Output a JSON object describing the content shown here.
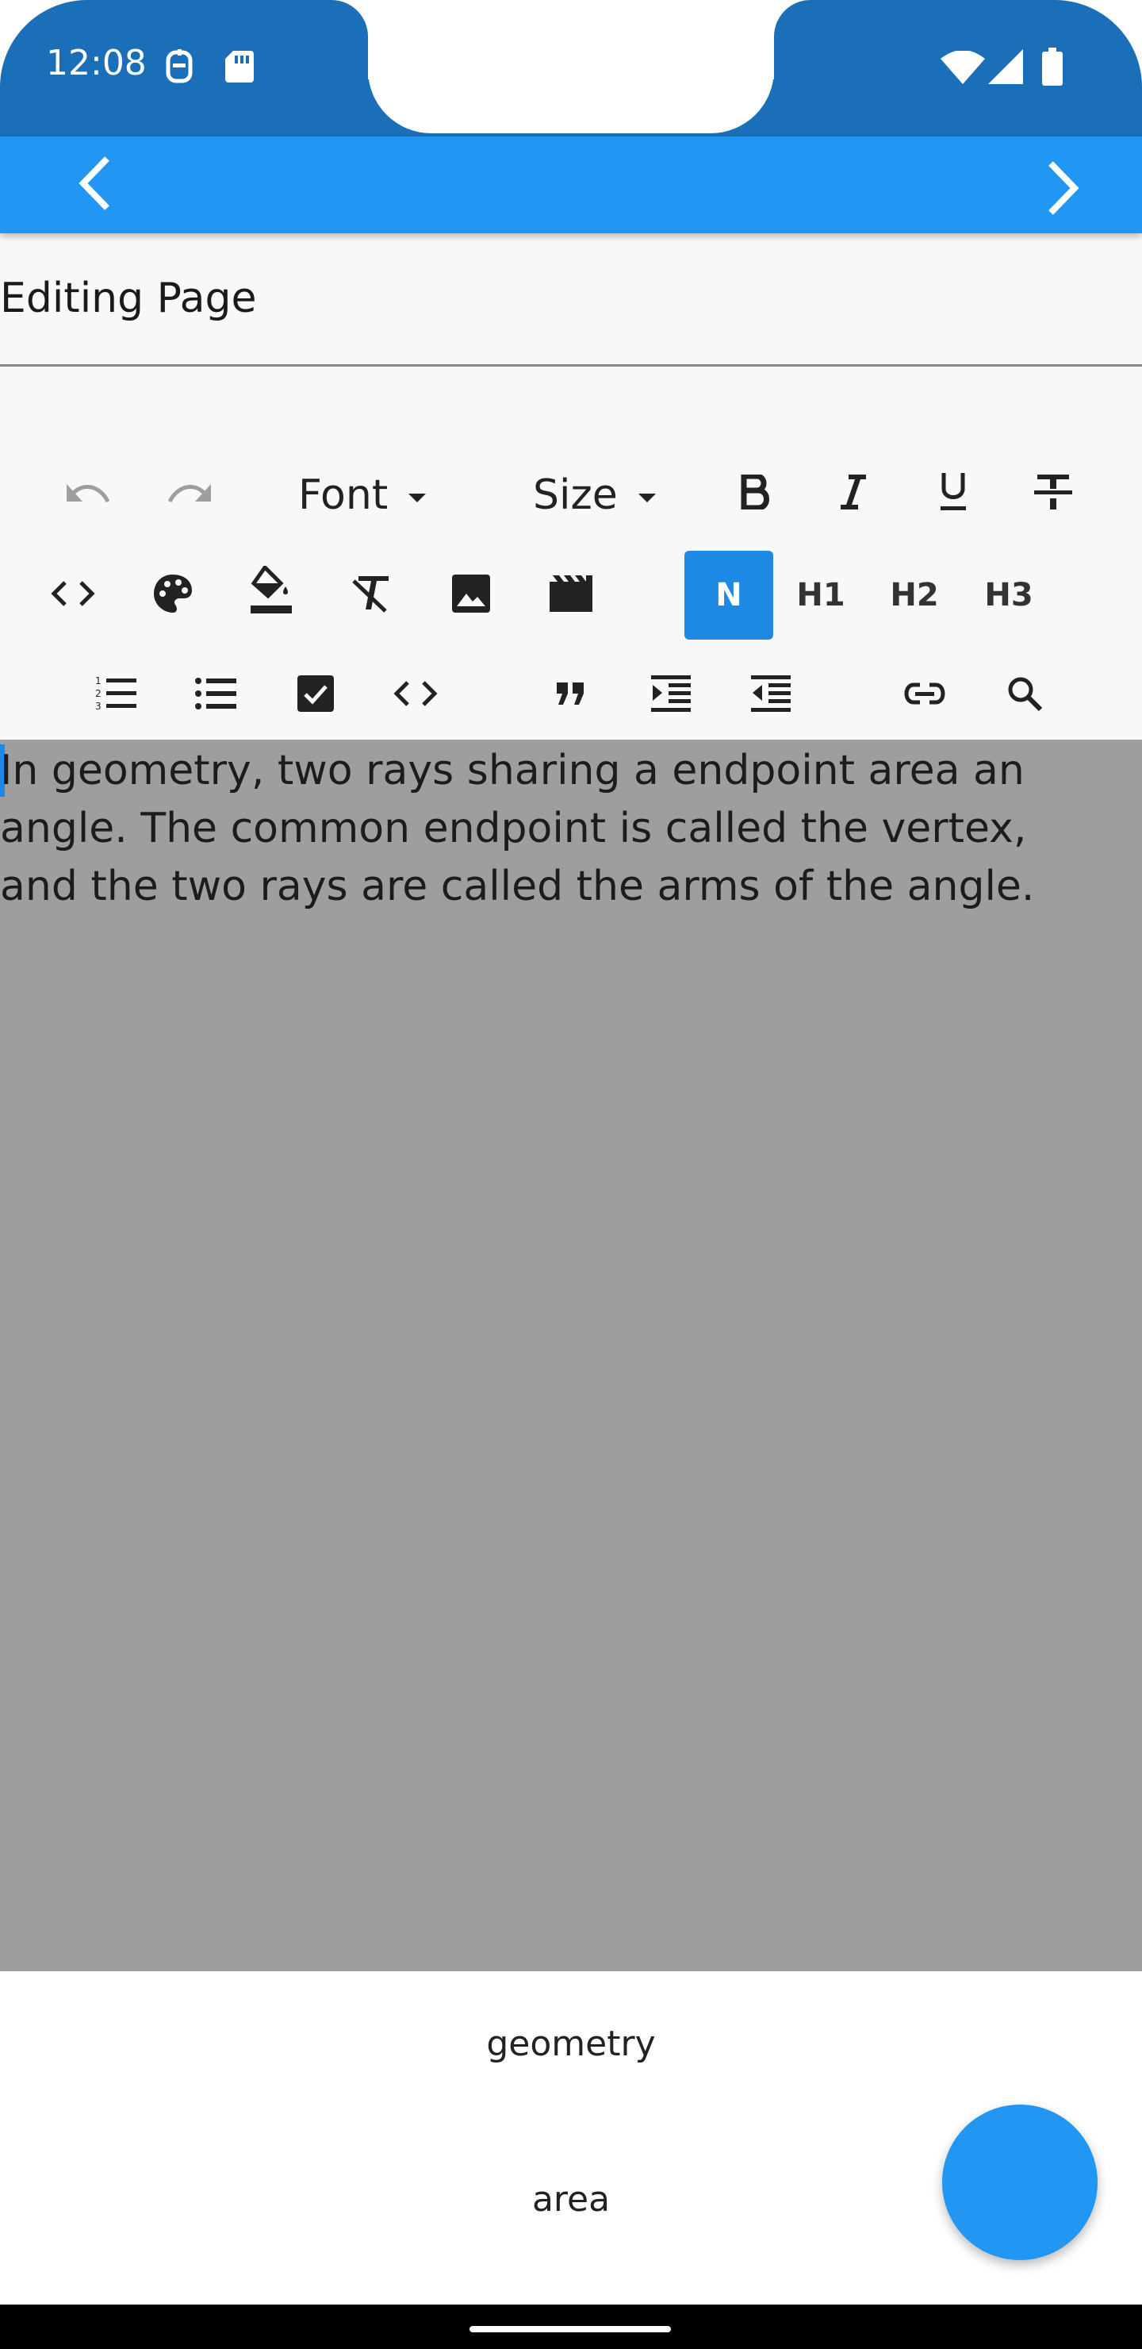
{
  "status_bar": {
    "time": "12:08",
    "background": "#1b6fb8",
    "icons": [
      "notification-icon",
      "sd-card-icon",
      "wifi-icon",
      "signal-icon",
      "battery-icon"
    ]
  },
  "app_bar": {
    "background": "#2196f3",
    "back_icon": "chevron-left-icon",
    "forward_icon": "chevron-right-icon"
  },
  "title_field": {
    "value": "Editing Page"
  },
  "toolbar": {
    "font_label": "Font",
    "size_label": "Size",
    "headings": [
      "N",
      "H1",
      "H2",
      "H3"
    ],
    "active_heading": "N",
    "accent": "#1e88e5"
  },
  "editor": {
    "text": "In geometry, two rays sharing a endpoint area an angle. The common endpoint is called the vertex, and the two rays are called the arms of the angle.",
    "background": "#9e9e9e"
  },
  "suggestions": [
    "geometry",
    "area"
  ],
  "fab": {
    "color": "#2196f3"
  }
}
